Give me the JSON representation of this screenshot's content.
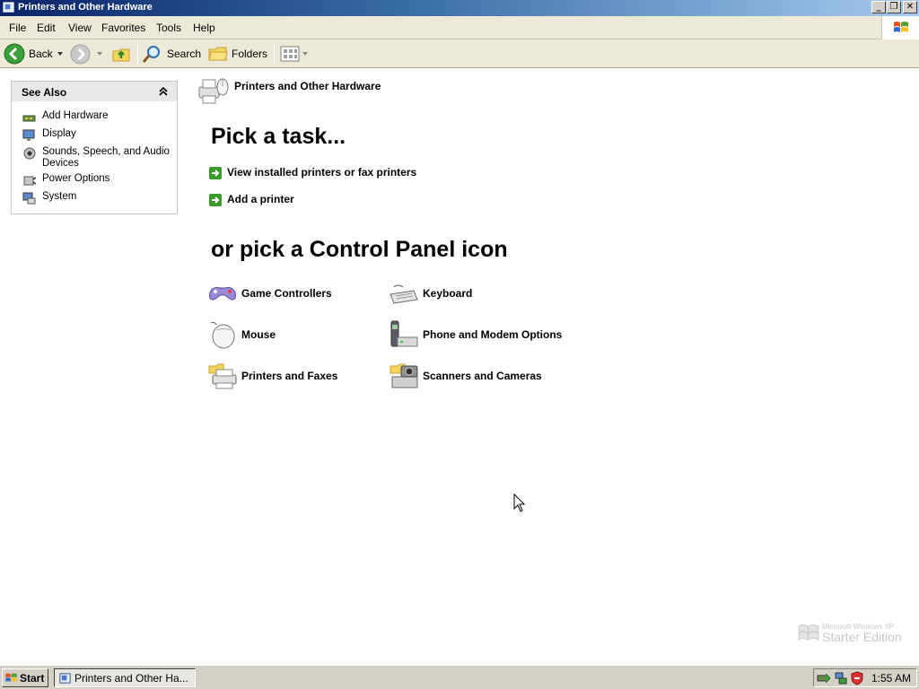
{
  "window": {
    "title": "Printers and Other Hardware",
    "controls": {
      "minimize": "_",
      "restore": "❐",
      "close": "✕"
    }
  },
  "menubar": {
    "items": [
      "File",
      "Edit",
      "View",
      "Favorites",
      "Tools",
      "Help"
    ]
  },
  "toolbar": {
    "back_label": "Back",
    "search_label": "Search",
    "folders_label": "Folders"
  },
  "see_also": {
    "title": "See Also",
    "items": [
      {
        "label": "Add Hardware",
        "icon": "add-hardware-icon"
      },
      {
        "label": "Display",
        "icon": "display-icon"
      },
      {
        "label": "Sounds, Speech, and Audio Devices",
        "icon": "sounds-icon"
      },
      {
        "label": "Power Options",
        "icon": "power-icon"
      },
      {
        "label": "System",
        "icon": "system-icon"
      }
    ]
  },
  "main": {
    "category_title": "Printers and Other Hardware",
    "pick_task_heading": "Pick a task...",
    "tasks": [
      "View installed printers or fax printers",
      "Add a printer"
    ],
    "pick_icon_heading": "or pick a Control Panel icon",
    "icons": [
      {
        "label": "Game Controllers",
        "icon": "game-controller-icon"
      },
      {
        "label": "Keyboard",
        "icon": "keyboard-icon"
      },
      {
        "label": "Mouse",
        "icon": "mouse-icon"
      },
      {
        "label": "Phone and Modem Options",
        "icon": "phone-modem-icon"
      },
      {
        "label": "Printers and Faxes",
        "icon": "printer-icon"
      },
      {
        "label": "Scanners and Cameras",
        "icon": "scanner-camera-icon"
      }
    ]
  },
  "watermark": {
    "line1": "Microsoft Windows XP",
    "line2": "Starter Edition"
  },
  "taskbar": {
    "start_label": "Start",
    "task_item_label": "Printers and Other Ha...",
    "clock": "1:55 AM"
  }
}
